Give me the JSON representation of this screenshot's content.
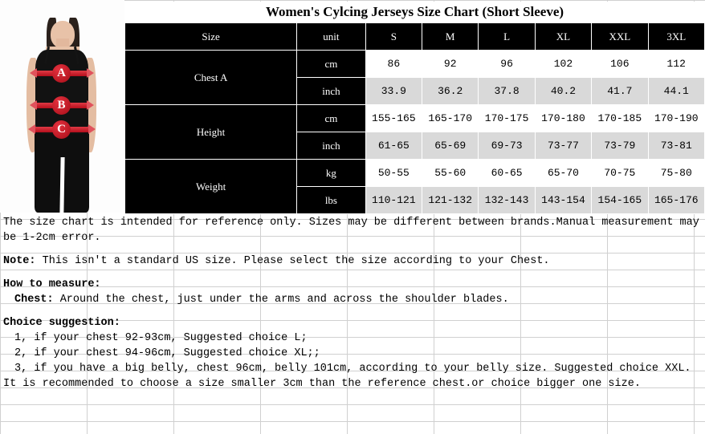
{
  "chart_title": "Women's Cylcing Jerseys Size Chart (Short Sleeve)",
  "photo": {
    "alt": "woman in black camisole with measurement bands",
    "bands": [
      {
        "label": "A",
        "meaning": "chest"
      },
      {
        "label": "B",
        "meaning": "waist"
      },
      {
        "label": "C",
        "meaning": "hip"
      }
    ],
    "band_color": "#b40f1c"
  },
  "table": {
    "header": [
      "Size",
      "unit",
      "S",
      "M",
      "L",
      "XL",
      "XXL",
      "3XL"
    ],
    "groups": [
      {
        "label": "Chest A",
        "rows": [
          {
            "unit": "cm",
            "values": [
              "86",
              "92",
              "96",
              "102",
              "106",
              "112"
            ],
            "style": "white"
          },
          {
            "unit": "inch",
            "values": [
              "33.9",
              "36.2",
              "37.8",
              "40.2",
              "41.7",
              "44.1"
            ],
            "style": "gray"
          }
        ]
      },
      {
        "label": "Height",
        "rows": [
          {
            "unit": "cm",
            "values": [
              "155-165",
              "165-170",
              "170-175",
              "170-180",
              "170-185",
              "170-190"
            ],
            "style": "white"
          },
          {
            "unit": "inch",
            "values": [
              "61-65",
              "65-69",
              "69-73",
              "73-77",
              "73-79",
              "73-81"
            ],
            "style": "gray"
          }
        ]
      },
      {
        "label": "Weight",
        "rows": [
          {
            "unit": "kg",
            "values": [
              "50-55",
              "55-60",
              "60-65",
              "65-70",
              "70-75",
              "75-80"
            ],
            "style": "white"
          },
          {
            "unit": "lbs",
            "values": [
              "110-121",
              "121-132",
              "132-143",
              "143-154",
              "154-165",
              "165-176"
            ],
            "style": "gray"
          }
        ]
      }
    ]
  },
  "notes": {
    "disclaimer": "The size chart is intended for reference only. Sizes may be different between brands.Manual measurement may be 1-2cm error.",
    "note_label": "Note:",
    "note_text": " This isn't a standard US size. Please select the size according to your Chest.",
    "how_to_measure_title": "How to measure:",
    "chest_label": "Chest:",
    "chest_text": " Around the chest, just under the arms and across the shoulder blades.",
    "choice_title": "Choice suggestion:",
    "choice_1": "1, if your chest 92-93cm, Suggested choice L;",
    "choice_2": "2, if your chest 94-96cm, Suggested choice XL;;",
    "choice_3": "3, if you have a big belly, chest 96cm, belly 101cm, according to your belly size. Suggested choice XXL.",
    "recommendation": "It is recommended to choose a size smaller 3cm than the reference chest.or choice bigger one size."
  }
}
